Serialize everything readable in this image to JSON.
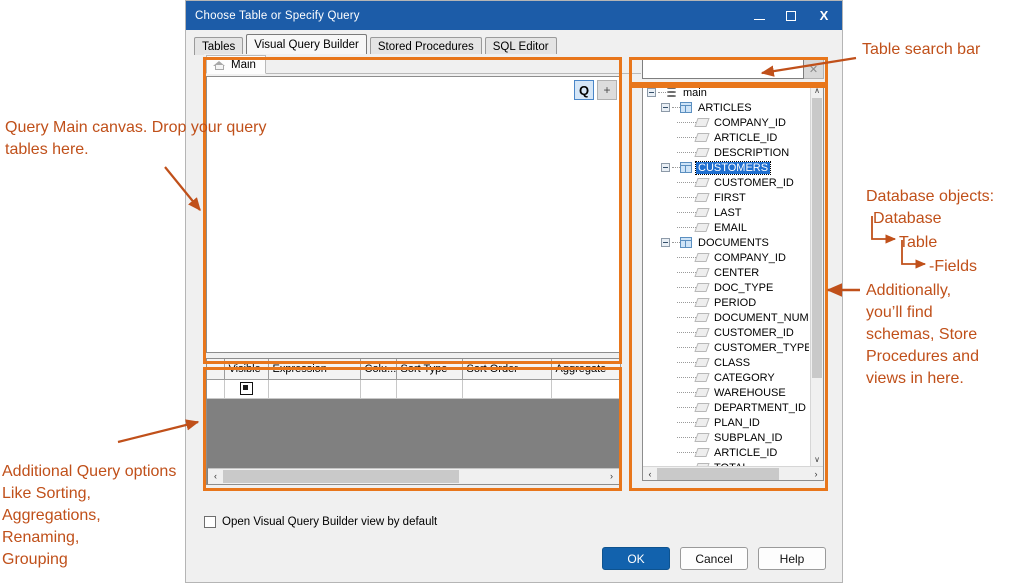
{
  "window": {
    "title": "Choose Table or Specify Query",
    "controls": {
      "minimize": "–",
      "maximize": "□",
      "close": "X"
    }
  },
  "tabs": [
    {
      "label": "Tables",
      "active": false
    },
    {
      "label": "Visual Query Builder",
      "active": true
    },
    {
      "label": "Stored Procedures",
      "active": false
    },
    {
      "label": "SQL Editor",
      "active": false
    }
  ],
  "canvas": {
    "tab_label": "Main",
    "tab_icon": "home-icon",
    "buttons": [
      {
        "label": "Q",
        "name": "query-toggle-button"
      },
      {
        "label": "+",
        "name": "add-table-button"
      }
    ]
  },
  "grid": {
    "columns": [
      "",
      "Visible",
      "Expression",
      "Colu...",
      "Sort Type",
      "Sort Order",
      "Aggregate"
    ],
    "rows": [
      {
        "rowheader": "",
        "visible_checked": true,
        "expression": "",
        "column": "",
        "sort_type": "",
        "sort_order": "",
        "aggregate": ""
      }
    ],
    "scroll_left_arrow": "‹",
    "scroll_right_arrow": "›"
  },
  "search": {
    "value": "",
    "placeholder": "",
    "clear_icon": "close-icon",
    "clear_label": "✕"
  },
  "tree": {
    "scroll_up": "∧",
    "scroll_down": "∨",
    "scroll_left": "‹",
    "scroll_right": "›",
    "nodes": [
      {
        "label": "main",
        "level": 0,
        "icon": "database-icon",
        "expander": "minus",
        "selected": false
      },
      {
        "label": "ARTICLES",
        "level": 1,
        "icon": "table-icon",
        "expander": "minus",
        "selected": false
      },
      {
        "label": "COMPANY_ID",
        "level": 2,
        "icon": "field-icon",
        "expander": "none",
        "selected": false
      },
      {
        "label": "ARTICLE_ID",
        "level": 2,
        "icon": "field-icon",
        "expander": "none",
        "selected": false
      },
      {
        "label": "DESCRIPTION",
        "level": 2,
        "icon": "field-icon",
        "expander": "none",
        "selected": false
      },
      {
        "label": "CUSTOMERS",
        "level": 1,
        "icon": "table-icon",
        "expander": "minus",
        "selected": true
      },
      {
        "label": "CUSTOMER_ID",
        "level": 2,
        "icon": "field-icon",
        "expander": "none",
        "selected": false
      },
      {
        "label": "FIRST",
        "level": 2,
        "icon": "field-icon",
        "expander": "none",
        "selected": false
      },
      {
        "label": "LAST",
        "level": 2,
        "icon": "field-icon",
        "expander": "none",
        "selected": false
      },
      {
        "label": "EMAIL",
        "level": 2,
        "icon": "field-icon",
        "expander": "none",
        "selected": false
      },
      {
        "label": "DOCUMENTS",
        "level": 1,
        "icon": "table-icon",
        "expander": "minus",
        "selected": false
      },
      {
        "label": "COMPANY_ID",
        "level": 2,
        "icon": "field-icon",
        "expander": "none",
        "selected": false
      },
      {
        "label": "CENTER",
        "level": 2,
        "icon": "field-icon",
        "expander": "none",
        "selected": false
      },
      {
        "label": "DOC_TYPE",
        "level": 2,
        "icon": "field-icon",
        "expander": "none",
        "selected": false
      },
      {
        "label": "PERIOD",
        "level": 2,
        "icon": "field-icon",
        "expander": "none",
        "selected": false
      },
      {
        "label": "DOCUMENT_NUMBER",
        "level": 2,
        "icon": "field-icon",
        "expander": "none",
        "selected": false
      },
      {
        "label": "CUSTOMER_ID",
        "level": 2,
        "icon": "field-icon",
        "expander": "none",
        "selected": false
      },
      {
        "label": "CUSTOMER_TYPE",
        "level": 2,
        "icon": "field-icon",
        "expander": "none",
        "selected": false
      },
      {
        "label": "CLASS",
        "level": 2,
        "icon": "field-icon",
        "expander": "none",
        "selected": false
      },
      {
        "label": "CATEGORY",
        "level": 2,
        "icon": "field-icon",
        "expander": "none",
        "selected": false
      },
      {
        "label": "WAREHOUSE",
        "level": 2,
        "icon": "field-icon",
        "expander": "none",
        "selected": false
      },
      {
        "label": "DEPARTMENT_ID",
        "level": 2,
        "icon": "field-icon",
        "expander": "none",
        "selected": false
      },
      {
        "label": "PLAN_ID",
        "level": 2,
        "icon": "field-icon",
        "expander": "none",
        "selected": false
      },
      {
        "label": "SUBPLAN_ID",
        "level": 2,
        "icon": "field-icon",
        "expander": "none",
        "selected": false
      },
      {
        "label": "ARTICLE_ID",
        "level": 2,
        "icon": "field-icon",
        "expander": "none",
        "selected": false
      },
      {
        "label": "TOTAL",
        "level": 2,
        "icon": "field-icon",
        "expander": "none",
        "selected": false
      }
    ]
  },
  "footer": {
    "checkbox_label": "Open Visual Query Builder view by default",
    "checkbox_checked": false,
    "buttons": [
      {
        "label": "OK",
        "primary": true
      },
      {
        "label": "Cancel",
        "primary": false
      },
      {
        "label": "Help",
        "primary": false
      }
    ]
  },
  "annotations": {
    "canvas": "Query Main canvas. Drop your query\ntables here.",
    "grid": "Additional Query options\nLike Sorting,\nAggregations,\nRenaming,\nGrouping",
    "search": "Table search bar",
    "objects_title": "Database objects:",
    "objects_db": "Database",
    "objects_table": "Table",
    "objects_fields": "-Fields",
    "objects_more": "Additionally,\nyou’ll find\nschemas, Store\nProcedures and\nviews in here."
  },
  "colors": {
    "accent_orange": "#e8761b",
    "annotation_text": "#c0501a",
    "titlebar_blue": "#1c5ca8",
    "selection_blue": "#1f6fd0",
    "primary_button": "#1262ad"
  }
}
